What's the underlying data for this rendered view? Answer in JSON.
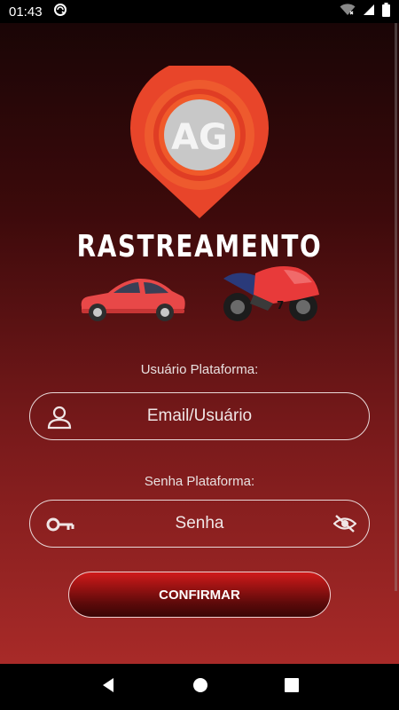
{
  "status_bar": {
    "time": "01:43"
  },
  "logo": {
    "initials": "AG"
  },
  "brand": {
    "title": "RASTREAMENTO"
  },
  "form": {
    "username_label": "Usuário Plataforma:",
    "username_placeholder": "Email/Usuário",
    "password_label": "Senha Plataforma:",
    "password_placeholder": "Senha",
    "confirm_label": "CONFIRMAR"
  },
  "colors": {
    "accent": "#e8452a",
    "button": "#b51515"
  }
}
